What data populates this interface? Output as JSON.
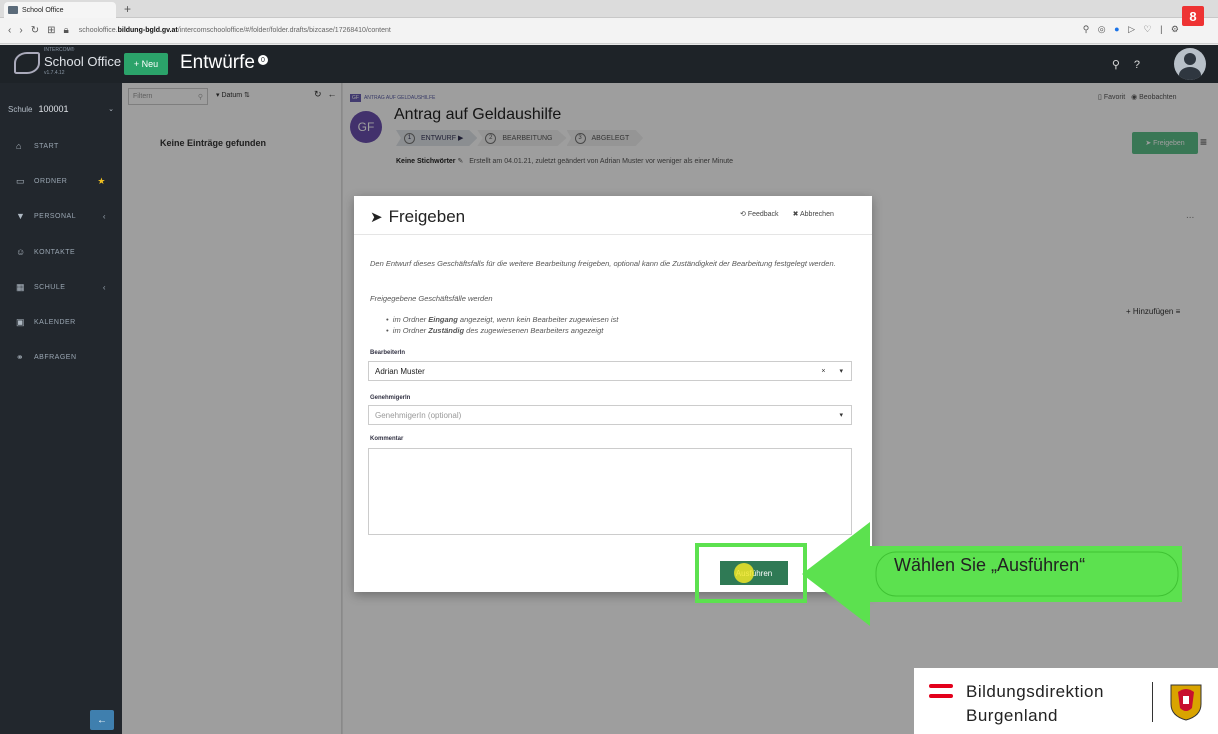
{
  "browser": {
    "tab_title": "School Office",
    "new_tab": "+",
    "url_prefix": "schooloffice.",
    "url_domain": "bildung-bgld.gv.at",
    "url_path": "/intercomschooloffice/#/folder/folder.drafts/bizcase/17268410/content",
    "step_badge": "8"
  },
  "app": {
    "brand_small": "INTERCOM®",
    "brand": "School Office",
    "version": "v1.7.4.12",
    "new_button": "+ Neu",
    "page_title": "Entwürfe",
    "title_count": "0",
    "help": "?"
  },
  "sidebar": {
    "school_label": "Schule",
    "school_value": "100001",
    "items": [
      {
        "label": "Start",
        "icon": "home-icon"
      },
      {
        "label": "Ordner",
        "icon": "folder-icon"
      },
      {
        "label": "Personal",
        "icon": "graduation-icon"
      },
      {
        "label": "Kontakte",
        "icon": "contacts-icon"
      },
      {
        "label": "Schule",
        "icon": "building-icon"
      },
      {
        "label": "Kalender",
        "icon": "calendar-icon"
      },
      {
        "label": "Abfragen",
        "icon": "binoculars-icon"
      }
    ]
  },
  "list": {
    "filter_placeholder": "Filtern",
    "sort_label": "▾ Datum",
    "empty_text": "Keine Einträge gefunden"
  },
  "case": {
    "crumb_tag": "GF",
    "crumb": "Antrag auf Geldaushilfe",
    "avatar": "GF",
    "title": "Antrag auf Geldaushilfe",
    "steps": [
      {
        "n": "1",
        "label": "ENTWURF ▶"
      },
      {
        "n": "2",
        "label": "BEARBEITUNG"
      },
      {
        "n": "3",
        "label": "ABGELEGT"
      }
    ],
    "keywords": "Keine Stichwörter",
    "meta": "Erstellt am 04.01.21, zuletzt geändert von Adrian Muster  vor weniger als einer Minute",
    "freigeben_button": "Freigeben",
    "favorit": "Favorit",
    "beobachten": "Beobachten",
    "hinzufuegen": "Hinzufügen",
    "more": "..."
  },
  "modal": {
    "title": "Freigeben",
    "feedback": "Feedback",
    "cancel": "Abbrechen",
    "intro": "Den Entwurf dieses Geschäftsfalls für die weitere Bearbeitung freigeben, optional kann die Zuständigkeit der Bearbeitung festgelegt werden.",
    "sub": "Freigegebene Geschäftsfälle werden",
    "bullet1_pre": "im Ordner ",
    "bullet1_bold": "Eingang",
    "bullet1_post": " angezeigt, wenn kein Bearbeiter zugewiesen ist",
    "bullet2_pre": "im Ordner ",
    "bullet2_bold": "Zuständig",
    "bullet2_post": " des zugewiesenen Bearbeiters angezeigt",
    "assignee_label": "BearbeiterIn",
    "assignee_value": "Adrian Muster",
    "approver_label": "GenehmigerIn",
    "approver_placeholder": "GenehmigerIn (optional)",
    "comment_label": "Kommentar",
    "run_button": "Ausführen"
  },
  "callout": {
    "text": "Wählen Sie „Ausführen“"
  },
  "footer_logo": {
    "line1": "Bildungsdirektion",
    "line2": "Burgenland"
  },
  "colors": {
    "accent_green": "#2ba36a",
    "callout_green": "#5ce14f",
    "sidebar": "#22272d",
    "case_purple": "#6b4fae"
  }
}
